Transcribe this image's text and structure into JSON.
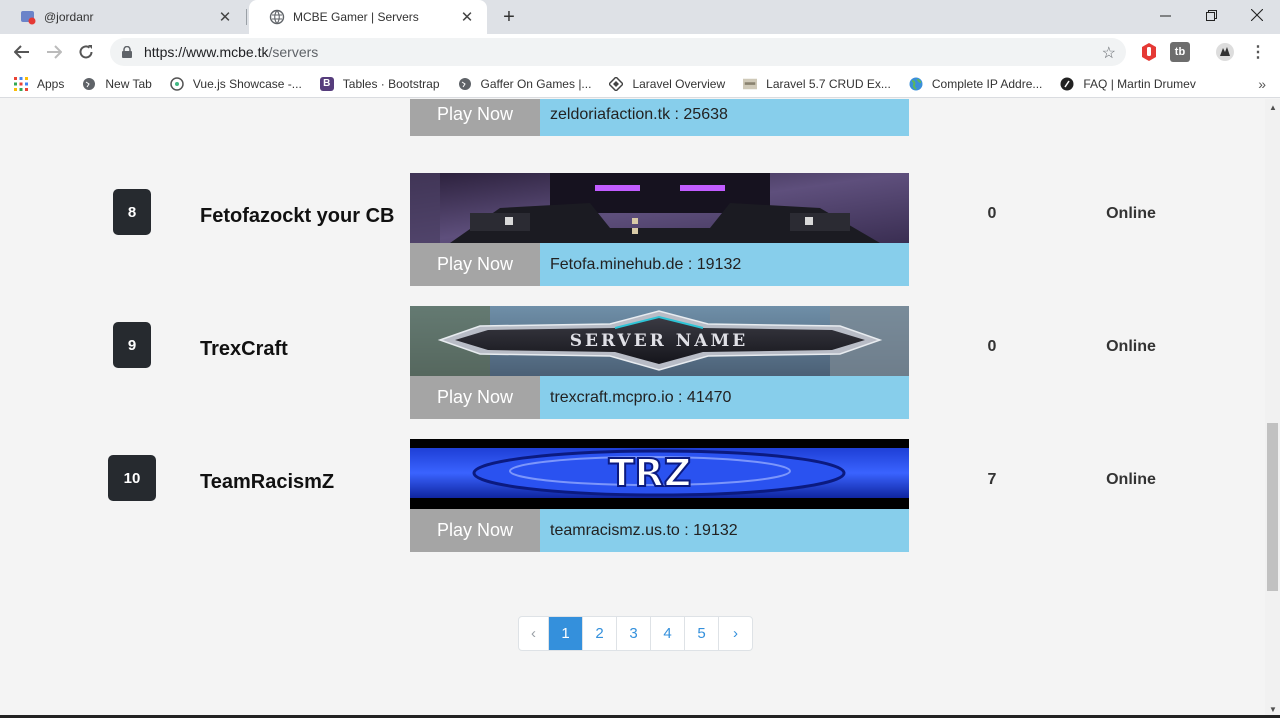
{
  "browser": {
    "tabs": [
      {
        "title": "@jordanr",
        "active": false
      },
      {
        "title": "MCBE Gamer | Servers",
        "active": true
      }
    ],
    "url_host": "https://www.mcbe.tk",
    "url_path": "/servers",
    "bookmarks": [
      {
        "label": "Apps",
        "icon": "apps-grid-icon"
      },
      {
        "label": "New Tab",
        "icon": "globe-icon"
      },
      {
        "label": "Vue.js Showcase -...",
        "icon": "vue-icon"
      },
      {
        "label": "Tables · Bootstrap",
        "icon": "bootstrap-icon"
      },
      {
        "label": "Gaffer On Games |...",
        "icon": "globe-icon"
      },
      {
        "label": "Laravel Overview",
        "icon": "laravel-icon"
      },
      {
        "label": "Laravel 5.7 CRUD Ex...",
        "icon": "site-icon"
      },
      {
        "label": "Complete IP Addre...",
        "icon": "earth-icon"
      },
      {
        "label": "FAQ | Martin Drumev",
        "icon": "site-icon"
      }
    ]
  },
  "partial_row": {
    "play_label": "Play Now",
    "ip": "zeldoriafaction.tk : 25638"
  },
  "servers": [
    {
      "rank": "8",
      "name": "Fetofazockt your CB",
      "play_label": "Play Now",
      "ip": "Fetofa.minehub.de : 19132",
      "players": "0",
      "status": "Online"
    },
    {
      "rank": "9",
      "name": "TrexCraft",
      "play_label": "Play Now",
      "ip": "trexcraft.mcpro.io : 41470",
      "players": "0",
      "status": "Online",
      "banner_text": "SERVER NAME"
    },
    {
      "rank": "10",
      "name": "TeamRacismZ",
      "play_label": "Play Now",
      "ip": "teamracismz.us.to : 19132",
      "players": "7",
      "status": "Online",
      "banner_text": "TRZ"
    }
  ],
  "pagination": {
    "prev": "‹",
    "pages": [
      "1",
      "2",
      "3",
      "4",
      "5"
    ],
    "next": "›",
    "current": "1"
  },
  "colors": {
    "play_button": "#a5a5a5",
    "ip_bar": "#87ceeb",
    "rank_badge": "#262a2f",
    "page_active": "#3490dc"
  }
}
